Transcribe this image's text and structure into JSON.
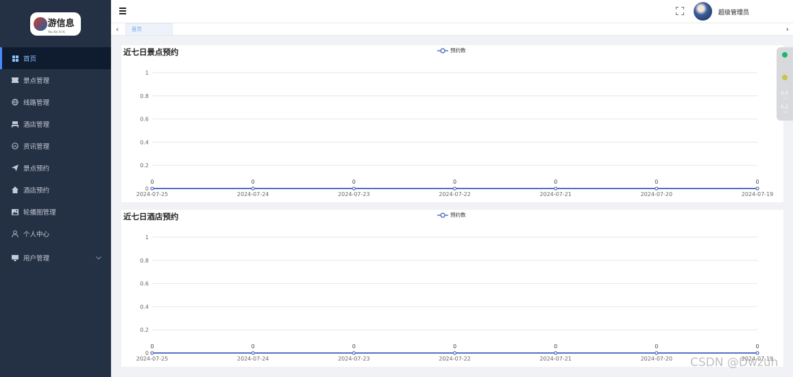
{
  "logo": {
    "title": "游信息",
    "subtitle": "You Xin Xi Xi"
  },
  "sidebar": {
    "items": [
      {
        "label": "首页",
        "icon": "grid-icon",
        "active": true
      },
      {
        "label": "景点管理",
        "icon": "ticket-icon"
      },
      {
        "label": "线路管理",
        "icon": "globe-icon"
      },
      {
        "label": "酒店管理",
        "icon": "bed-icon"
      },
      {
        "label": "资讯管理",
        "icon": "dashboard-icon"
      },
      {
        "label": "景点预约",
        "icon": "send-icon"
      },
      {
        "label": "酒店预约",
        "icon": "home-icon"
      },
      {
        "label": "轮播图管理",
        "icon": "image-icon"
      },
      {
        "label": "个人中心",
        "icon": "user-icon"
      },
      {
        "label": "用户管理",
        "icon": "monitor-icon",
        "has_submenu": true
      }
    ]
  },
  "topbar": {
    "user_name": "超级管理员"
  },
  "tabs": [
    {
      "label": "首页"
    }
  ],
  "widget": {
    "val1": "0.0",
    "unit1": "K/s",
    "val2": "0.2",
    "unit2": "K/s"
  },
  "watermark": "CSDN @Dwzun",
  "colors": {
    "sidebar_bg": "#243044",
    "active_bg": "#0f1b2e",
    "series": "#5470c6"
  },
  "chart_data": [
    {
      "type": "line",
      "title": "近七日景点预约",
      "categories": [
        "2024-07-25",
        "2024-07-24",
        "2024-07-23",
        "2024-07-22",
        "2024-07-21",
        "2024-07-20",
        "2024-07-19"
      ],
      "series": [
        {
          "name": "预约数",
          "values": [
            0,
            0,
            0,
            0,
            0,
            0,
            0
          ]
        }
      ],
      "yticks": [
        "0",
        "0.2",
        "0.4",
        "0.6",
        "0.8",
        "1"
      ],
      "ylim": [
        0,
        1
      ],
      "grid": true,
      "legend": "top-center"
    },
    {
      "type": "line",
      "title": "近七日酒店预约",
      "categories": [
        "2024-07-25",
        "2024-07-24",
        "2024-07-23",
        "2024-07-22",
        "2024-07-21",
        "2024-07-20",
        "2024-07-19"
      ],
      "series": [
        {
          "name": "预约数",
          "values": [
            0,
            0,
            0,
            0,
            0,
            0,
            0
          ]
        }
      ],
      "yticks": [
        "0",
        "0.2",
        "0.4",
        "0.6",
        "0.8",
        "1"
      ],
      "ylim": [
        0,
        1
      ],
      "grid": true,
      "legend": "top-center"
    }
  ]
}
